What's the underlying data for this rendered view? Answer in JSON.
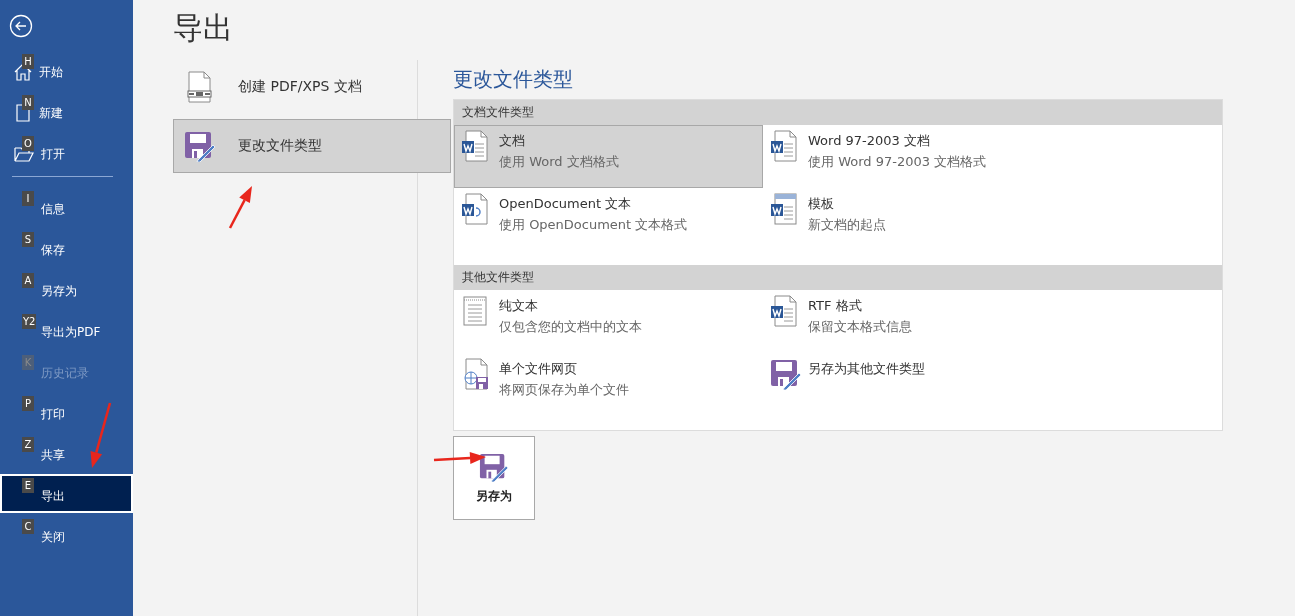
{
  "sidebar": {
    "top_items": [
      {
        "label": "开始",
        "key": "H",
        "kind": "home",
        "selected": false,
        "disabled": false
      },
      {
        "label": "新建",
        "key": "N",
        "kind": "new",
        "selected": false,
        "disabled": false
      },
      {
        "label": "打开",
        "key": "O",
        "kind": "open",
        "selected": false,
        "disabled": false
      }
    ],
    "items": [
      {
        "label": "信息",
        "key": "I",
        "selected": false,
        "disabled": false
      },
      {
        "label": "保存",
        "key": "S",
        "selected": false,
        "disabled": false
      },
      {
        "label": "另存为",
        "key": "A",
        "selected": false,
        "disabled": false
      },
      {
        "label": "导出为PDF",
        "key": "Y2",
        "selected": false,
        "disabled": false
      },
      {
        "label": "历史记录",
        "key": "K",
        "selected": false,
        "disabled": true
      },
      {
        "label": "打印",
        "key": "P",
        "selected": false,
        "disabled": false
      },
      {
        "label": "共享",
        "key": "Z",
        "selected": false,
        "disabled": false
      },
      {
        "label": "导出",
        "key": "E",
        "selected": true,
        "disabled": false
      },
      {
        "label": "关闭",
        "key": "C",
        "selected": false,
        "disabled": false
      }
    ]
  },
  "title": "导出",
  "export_options": [
    {
      "label": "创建 PDF/XPS 文档",
      "kind": "pdf",
      "selected": false
    },
    {
      "label": "更改文件类型",
      "kind": "save",
      "selected": true
    }
  ],
  "file_types": {
    "heading": "更改文件类型",
    "groups": [
      {
        "title": "文档文件类型",
        "items": [
          {
            "name": "文档",
            "description": "使用 Word 文档格式",
            "kind": "word",
            "selected": true
          },
          {
            "name": "Word 97-2003 文档",
            "description": "使用 Word 97-2003 文档格式",
            "kind": "word97",
            "selected": false
          },
          {
            "name": "OpenDocument 文本",
            "description": "使用 OpenDocument 文本格式",
            "kind": "odt",
            "selected": false
          },
          {
            "name": "模板",
            "description": "新文档的起点",
            "kind": "template",
            "selected": false
          }
        ]
      },
      {
        "title": "其他文件类型",
        "items": [
          {
            "name": "纯文本",
            "description": "仅包含您的文档中的文本",
            "kind": "text",
            "selected": false
          },
          {
            "name": "RTF 格式",
            "description": "保留文本格式信息",
            "kind": "word97",
            "selected": false
          },
          {
            "name": "单个文件网页",
            "description": "将网页保存为单个文件",
            "kind": "web",
            "selected": false
          },
          {
            "name": "另存为其他文件类型",
            "kind": "save",
            "selected": false
          }
        ]
      }
    ]
  },
  "save_button": {
    "label": "另存为"
  }
}
